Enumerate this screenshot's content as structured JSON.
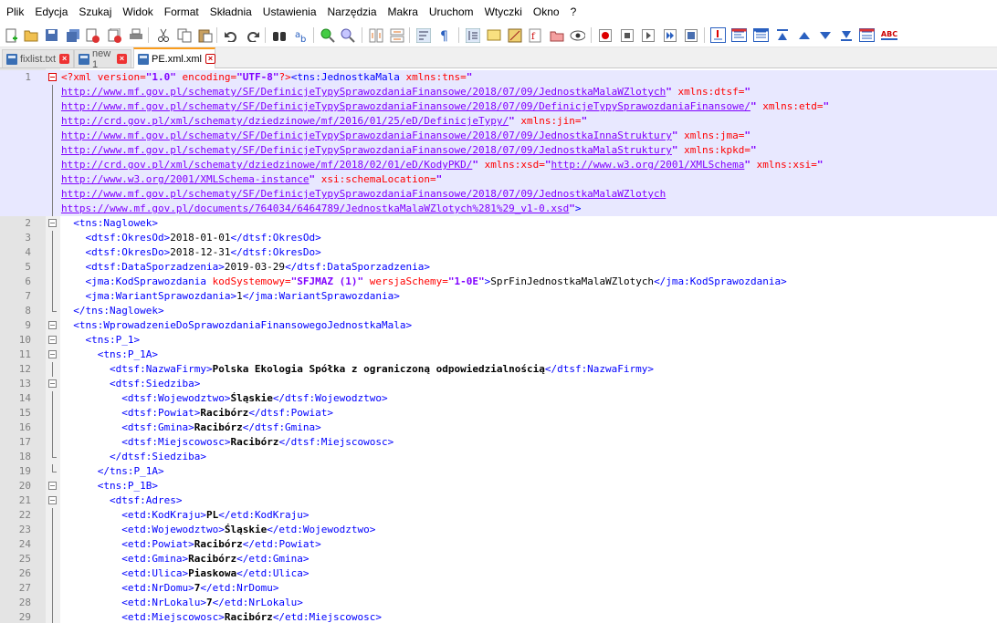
{
  "menu": [
    "Plik",
    "Edycja",
    "Szukaj",
    "Widok",
    "Format",
    "Składnia",
    "Ustawienia",
    "Narzędzia",
    "Makra",
    "Uruchom",
    "Wtyczki",
    "Okno",
    "?"
  ],
  "toolbar_icons": [
    "new-file-icon",
    "open-file-icon",
    "save-icon",
    "save-all-icon",
    "close-icon",
    "close-all-icon",
    "print-icon",
    "cut-icon",
    "copy-icon",
    "paste-icon",
    "undo-icon",
    "redo-icon",
    "find-icon",
    "replace-icon",
    "zoom-in-icon",
    "zoom-out-icon",
    "sync-vertical-icon",
    "sync-horizontal-icon",
    "word-wrap-icon",
    "show-all-chars-icon",
    "indent-guide-icon",
    "udl-icon",
    "doc-map-icon",
    "function-list-icon",
    "folder-as-workspace-icon",
    "monitor-icon",
    "record-macro-icon",
    "stop-record-icon",
    "play-macro-icon",
    "run-macro-multiple-icon",
    "save-macro-icon",
    "xml-check-icon",
    "pretty-print-icon",
    "linearize-icon",
    "go-top-icon",
    "go-up-icon",
    "go-down-icon",
    "go-bottom-icon",
    "collapse-icon",
    "spellcheck-icon"
  ],
  "tabs": [
    {
      "label": "fixlist.txt",
      "active": false
    },
    {
      "label": "new 1",
      "active": false
    },
    {
      "label": "PE.xml.xml",
      "active": true
    }
  ],
  "spellcheck_label": "ABC",
  "code": [
    {
      "n": "1",
      "fold": "open-red",
      "hl": true,
      "segs": [
        [
          "pi",
          "<?xml "
        ],
        [
          "a",
          "version="
        ],
        [
          "v",
          "\"1.0\""
        ],
        [
          "a",
          " encoding="
        ],
        [
          "v",
          "\"UTF-8\""
        ],
        [
          "pi",
          "?>"
        ],
        [
          "t",
          "<tns:JednostkaMala "
        ],
        [
          "a",
          "xmlns:tns="
        ],
        [
          "v",
          "\""
        ]
      ]
    },
    {
      "n": "",
      "fold": "line",
      "hl": true,
      "segs": [
        [
          "u",
          "http://www.mf.gov.pl/schematy/SF/DefinicjeTypySprawozdaniaFinansowe/2018/07/09/JednostkaMalaWZlotych"
        ],
        [
          "v",
          "\""
        ],
        [
          "a",
          " xmlns:dtsf="
        ],
        [
          "v",
          "\""
        ]
      ]
    },
    {
      "n": "",
      "fold": "line",
      "hl": true,
      "segs": [
        [
          "u",
          "http://www.mf.gov.pl/schematy/SF/DefinicjeTypySprawozdaniaFinansowe/2018/07/09/DefinicjeTypySprawozdaniaFinansowe/"
        ],
        [
          "v",
          "\""
        ],
        [
          "a",
          " xmlns:etd="
        ],
        [
          "v",
          "\""
        ]
      ]
    },
    {
      "n": "",
      "fold": "line",
      "hl": true,
      "segs": [
        [
          "u",
          "http://crd.gov.pl/xml/schematy/dziedzinowe/mf/2016/01/25/eD/DefinicjeTypy/"
        ],
        [
          "v",
          "\""
        ],
        [
          "a",
          " xmlns:jin="
        ],
        [
          "v",
          "\""
        ]
      ]
    },
    {
      "n": "",
      "fold": "line",
      "hl": true,
      "segs": [
        [
          "u",
          "http://www.mf.gov.pl/schematy/SF/DefinicjeTypySprawozdaniaFinansowe/2018/07/09/JednostkaInnaStruktury"
        ],
        [
          "v",
          "\""
        ],
        [
          "a",
          " xmlns:jma="
        ],
        [
          "v",
          "\""
        ]
      ]
    },
    {
      "n": "",
      "fold": "line",
      "hl": true,
      "segs": [
        [
          "u",
          "http://www.mf.gov.pl/schematy/SF/DefinicjeTypySprawozdaniaFinansowe/2018/07/09/JednostkaMalaStruktury"
        ],
        [
          "v",
          "\""
        ],
        [
          "a",
          " xmlns:kpkd="
        ],
        [
          "v",
          "\""
        ]
      ]
    },
    {
      "n": "",
      "fold": "line",
      "hl": true,
      "segs": [
        [
          "u",
          "http://crd.gov.pl/xml/schematy/dziedzinowe/mf/2018/02/01/eD/KodyPKD/"
        ],
        [
          "v",
          "\""
        ],
        [
          "a",
          " xmlns:xsd="
        ],
        [
          "v",
          "\""
        ],
        [
          "u",
          "http://www.w3.org/2001/XMLSchema"
        ],
        [
          "v",
          "\""
        ],
        [
          "a",
          " xmlns:xsi="
        ],
        [
          "v",
          "\""
        ]
      ]
    },
    {
      "n": "",
      "fold": "line",
      "hl": true,
      "segs": [
        [
          "u",
          "http://www.w3.org/2001/XMLSchema-instance"
        ],
        [
          "v",
          "\""
        ],
        [
          "a",
          " xsi:schemaLocation="
        ],
        [
          "v",
          "\""
        ]
      ]
    },
    {
      "n": "",
      "fold": "line",
      "hl": true,
      "segs": [
        [
          "u",
          "http://www.mf.gov.pl/schematy/SF/DefinicjeTypySprawozdaniaFinansowe/2018/07/09/JednostkaMalaWZlotych"
        ]
      ]
    },
    {
      "n": "",
      "fold": "line",
      "hl": true,
      "segs": [
        [
          "u",
          "https://www.mf.gov.pl/documents/764034/6464789/JednostkaMalaWZlotych%281%29_v1-0.xsd"
        ],
        [
          "v",
          "\""
        ],
        [
          "t",
          ">"
        ]
      ]
    },
    {
      "n": "2",
      "fold": "open",
      "segs": [
        [
          "x",
          "  "
        ],
        [
          "t",
          "<tns:Naglowek>"
        ]
      ]
    },
    {
      "n": "3",
      "fold": "line",
      "segs": [
        [
          "x",
          "    "
        ],
        [
          "t",
          "<dtsf:OkresOd>"
        ],
        [
          "x",
          "2018-01-01"
        ],
        [
          "t",
          "</dtsf:OkresOd>"
        ]
      ]
    },
    {
      "n": "4",
      "fold": "line",
      "segs": [
        [
          "x",
          "    "
        ],
        [
          "t",
          "<dtsf:OkresDo>"
        ],
        [
          "x",
          "2018-12-31"
        ],
        [
          "t",
          "</dtsf:OkresDo>"
        ]
      ]
    },
    {
      "n": "5",
      "fold": "line",
      "segs": [
        [
          "x",
          "    "
        ],
        [
          "t",
          "<dtsf:DataSporzadzenia>"
        ],
        [
          "x",
          "2019-03-29"
        ],
        [
          "t",
          "</dtsf:DataSporzadzenia>"
        ]
      ]
    },
    {
      "n": "6",
      "fold": "line",
      "segs": [
        [
          "x",
          "    "
        ],
        [
          "t",
          "<jma:KodSprawozdania "
        ],
        [
          "a",
          "kodSystemowy="
        ],
        [
          "v",
          "\"SFJMAZ (1)\""
        ],
        [
          "a",
          " wersjaSchemy="
        ],
        [
          "v",
          "\"1-0E\""
        ],
        [
          "t",
          ">"
        ],
        [
          "x",
          "SprFinJednostkaMalaWZlotych"
        ],
        [
          "t",
          "</jma:KodSprawozdania>"
        ]
      ]
    },
    {
      "n": "7",
      "fold": "line",
      "segs": [
        [
          "x",
          "    "
        ],
        [
          "t",
          "<jma:WariantSprawozdania>"
        ],
        [
          "x",
          "1"
        ],
        [
          "t",
          "</jma:WariantSprawozdania>"
        ]
      ]
    },
    {
      "n": "8",
      "fold": "end",
      "segs": [
        [
          "x",
          "  "
        ],
        [
          "t",
          "</tns:Naglowek>"
        ]
      ]
    },
    {
      "n": "9",
      "fold": "open",
      "segs": [
        [
          "x",
          "  "
        ],
        [
          "t",
          "<tns:WprowadzenieDoSprawozdaniaFinansowegoJednostkaMala>"
        ]
      ]
    },
    {
      "n": "10",
      "fold": "open",
      "segs": [
        [
          "x",
          "    "
        ],
        [
          "t",
          "<tns:P_1>"
        ]
      ]
    },
    {
      "n": "11",
      "fold": "open",
      "segs": [
        [
          "x",
          "      "
        ],
        [
          "t",
          "<tns:P_1A>"
        ]
      ]
    },
    {
      "n": "12",
      "fold": "line",
      "segs": [
        [
          "x",
          "        "
        ],
        [
          "t",
          "<dtsf:NazwaFirmy>"
        ],
        [
          "txt",
          "Polska Ekologia Spółka z ograniczoną odpowiedzialnością"
        ],
        [
          "t",
          "</dtsf:NazwaFirmy>"
        ]
      ]
    },
    {
      "n": "13",
      "fold": "open",
      "segs": [
        [
          "x",
          "        "
        ],
        [
          "t",
          "<dtsf:Siedziba>"
        ]
      ]
    },
    {
      "n": "14",
      "fold": "line",
      "segs": [
        [
          "x",
          "          "
        ],
        [
          "t",
          "<dtsf:Wojewodztwo>"
        ],
        [
          "txt",
          "Śląskie"
        ],
        [
          "t",
          "</dtsf:Wojewodztwo>"
        ]
      ]
    },
    {
      "n": "15",
      "fold": "line",
      "segs": [
        [
          "x",
          "          "
        ],
        [
          "t",
          "<dtsf:Powiat>"
        ],
        [
          "txt",
          "Racibórz"
        ],
        [
          "t",
          "</dtsf:Powiat>"
        ]
      ]
    },
    {
      "n": "16",
      "fold": "line",
      "segs": [
        [
          "x",
          "          "
        ],
        [
          "t",
          "<dtsf:Gmina>"
        ],
        [
          "txt",
          "Racibórz"
        ],
        [
          "t",
          "</dtsf:Gmina>"
        ]
      ]
    },
    {
      "n": "17",
      "fold": "line",
      "segs": [
        [
          "x",
          "          "
        ],
        [
          "t",
          "<dtsf:Miejscowosc>"
        ],
        [
          "txt",
          "Racibórz"
        ],
        [
          "t",
          "</dtsf:Miejscowosc>"
        ]
      ]
    },
    {
      "n": "18",
      "fold": "end",
      "segs": [
        [
          "x",
          "        "
        ],
        [
          "t",
          "</dtsf:Siedziba>"
        ]
      ]
    },
    {
      "n": "19",
      "fold": "end",
      "segs": [
        [
          "x",
          "      "
        ],
        [
          "t",
          "</tns:P_1A>"
        ]
      ]
    },
    {
      "n": "20",
      "fold": "open",
      "segs": [
        [
          "x",
          "      "
        ],
        [
          "t",
          "<tns:P_1B>"
        ]
      ]
    },
    {
      "n": "21",
      "fold": "open",
      "segs": [
        [
          "x",
          "        "
        ],
        [
          "t",
          "<dtsf:Adres>"
        ]
      ]
    },
    {
      "n": "22",
      "fold": "line",
      "segs": [
        [
          "x",
          "          "
        ],
        [
          "t",
          "<etd:KodKraju>"
        ],
        [
          "txt",
          "PL"
        ],
        [
          "t",
          "</etd:KodKraju>"
        ]
      ]
    },
    {
      "n": "23",
      "fold": "line",
      "segs": [
        [
          "x",
          "          "
        ],
        [
          "t",
          "<etd:Wojewodztwo>"
        ],
        [
          "txt",
          "Śląskie"
        ],
        [
          "t",
          "</etd:Wojewodztwo>"
        ]
      ]
    },
    {
      "n": "24",
      "fold": "line",
      "segs": [
        [
          "x",
          "          "
        ],
        [
          "t",
          "<etd:Powiat>"
        ],
        [
          "txt",
          "Racibórz"
        ],
        [
          "t",
          "</etd:Powiat>"
        ]
      ]
    },
    {
      "n": "25",
      "fold": "line",
      "segs": [
        [
          "x",
          "          "
        ],
        [
          "t",
          "<etd:Gmina>"
        ],
        [
          "txt",
          "Racibórz"
        ],
        [
          "t",
          "</etd:Gmina>"
        ]
      ]
    },
    {
      "n": "26",
      "fold": "line",
      "segs": [
        [
          "x",
          "          "
        ],
        [
          "t",
          "<etd:Ulica>"
        ],
        [
          "txt",
          "Piaskowa"
        ],
        [
          "t",
          "</etd:Ulica>"
        ]
      ]
    },
    {
      "n": "27",
      "fold": "line",
      "segs": [
        [
          "x",
          "          "
        ],
        [
          "t",
          "<etd:NrDomu>"
        ],
        [
          "txt",
          "7"
        ],
        [
          "t",
          "</etd:NrDomu>"
        ]
      ]
    },
    {
      "n": "28",
      "fold": "line",
      "segs": [
        [
          "x",
          "          "
        ],
        [
          "t",
          "<etd:NrLokalu>"
        ],
        [
          "txt",
          "7"
        ],
        [
          "t",
          "</etd:NrLokalu>"
        ]
      ]
    },
    {
      "n": "29",
      "fold": "line",
      "segs": [
        [
          "x",
          "          "
        ],
        [
          "t",
          "<etd:Miejscowosc>"
        ],
        [
          "txt",
          "Racibórz"
        ],
        [
          "t",
          "</etd:Miejscowosc>"
        ]
      ]
    }
  ]
}
